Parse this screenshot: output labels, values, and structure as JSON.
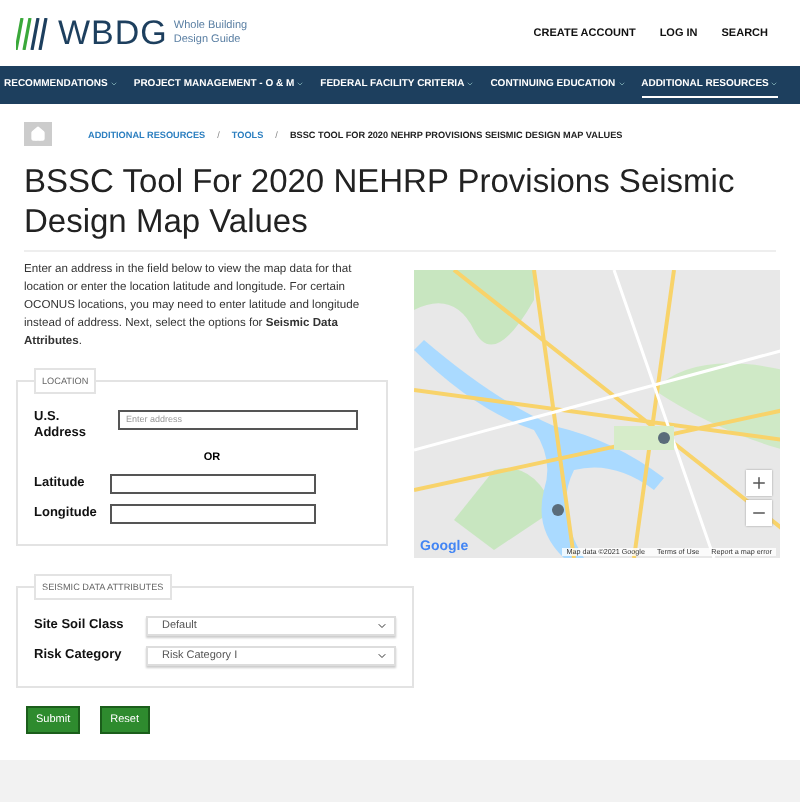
{
  "header": {
    "logo_text": "WBDG",
    "logo_subtitle": "Whole Building Design Guide",
    "links": [
      "CREATE ACCOUNT",
      "LOG IN",
      "SEARCH"
    ]
  },
  "nav": [
    {
      "label": "RECOMMENDATIONS",
      "selected": false
    },
    {
      "label": "PROJECT MANAGEMENT - O & M",
      "selected": false
    },
    {
      "label": "FEDERAL FACILITY CRITERIA",
      "selected": false
    },
    {
      "label": "CONTINUING EDUCATION",
      "selected": false
    },
    {
      "label": "ADDITIONAL RESOURCES",
      "selected": true
    }
  ],
  "breadcrumb_separator": "/",
  "breadcrumb": [
    {
      "label": "ADDITIONAL RESOURCES",
      "kind": "link"
    },
    {
      "label": "TOOLS",
      "kind": "link"
    },
    {
      "label": "BSSC TOOL FOR 2020 NEHRP PROVISIONS SEISMIC DESIGN MAP VALUES",
      "kind": "current"
    }
  ],
  "title": "BSSC Tool For 2020 NEHRP Provisions Seismic Design Map Values",
  "intro": "Enter an address in the field below to view the map data for that location or enter the location latitude and longitude. For certain OCONUS locations, you may need to enter latitude and longitude instead of address. Next, select the options for **Seismic Data Attributes**.",
  "location": {
    "legend": "LOCATION",
    "address_label": "U.S. Address",
    "address_placeholder": "Enter address",
    "or": "OR",
    "latitude_label": "Latitude",
    "longitude_label": "Longitude"
  },
  "map": {
    "kind": "picture",
    "logo": "Google",
    "footer": [
      "Map data ©2021 Google",
      "Terms of Use",
      "Report a map error"
    ]
  },
  "attributes": {
    "legend": "SEISMIC DATA ATTRIBUTES",
    "fields": [
      {
        "label": "Site Soil Class",
        "value": "Default"
      },
      {
        "label": "Risk Category",
        "value": "Risk Category I"
      }
    ]
  },
  "buttons": [
    "Submit",
    "Reset"
  ]
}
